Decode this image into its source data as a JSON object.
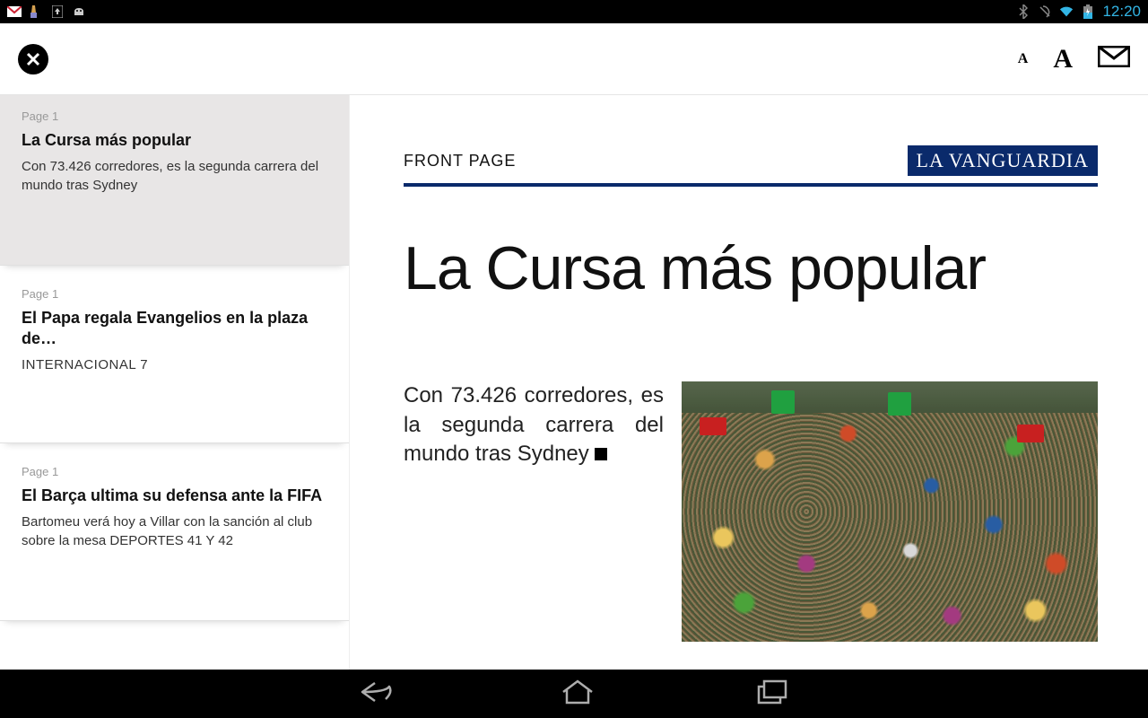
{
  "status": {
    "time": "12:20"
  },
  "appbar": {
    "font_small_label": "A",
    "font_large_label": "A"
  },
  "sidebar": {
    "items": [
      {
        "page": "Page 1",
        "title": "La Cursa más popular",
        "excerpt": "Con 73.426 corredores, es la segunda carrera del mundo tras Sydney",
        "category": ""
      },
      {
        "page": "Page 1",
        "title": "El Papa regala Evangelios en la plaza de…",
        "excerpt": "",
        "category": "INTERNACIONAL 7"
      },
      {
        "page": "Page 1",
        "title": "El Barça ultima su defensa ante la FIFA",
        "excerpt": "Bartomeu verá hoy a Villar con la sanción al club sobre la mesa DEPORTES 41 Y 42",
        "category": ""
      }
    ]
  },
  "article": {
    "section_label": "FRONT PAGE",
    "brand": "LA VANGUARDIA",
    "title": "La Cursa más popular",
    "lead": "Con 73.426 corredores, es la segunda carrera del mundo tras Sydney"
  }
}
